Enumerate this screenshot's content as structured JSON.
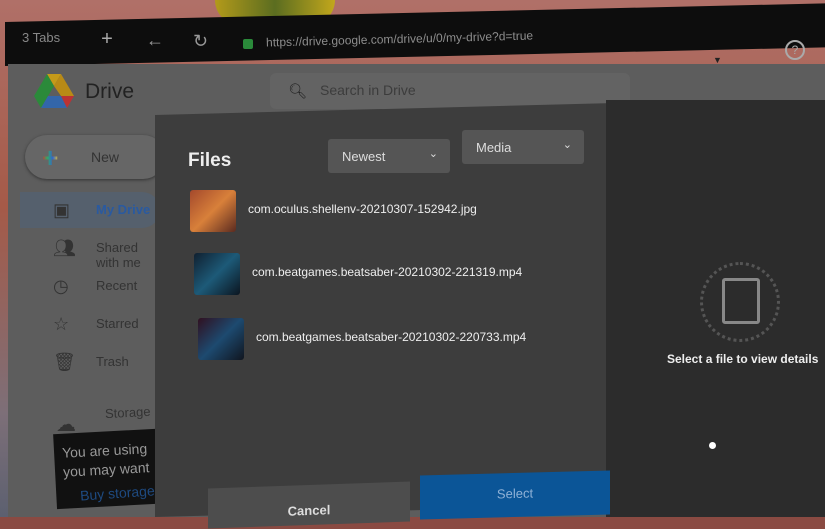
{
  "browser": {
    "tabs_label": "3 Tabs",
    "url": "https://drive.google.com/drive/u/0/my-drive?d=true"
  },
  "drive": {
    "brand": "Drive",
    "search_placeholder": "Search in Drive",
    "new_label": "New",
    "nav": [
      {
        "label": "My Drive",
        "icon": "my-drive-icon"
      },
      {
        "label": "Shared with me",
        "icon": "people-icon"
      },
      {
        "label": "Recent",
        "icon": "clock-icon"
      },
      {
        "label": "Starred",
        "icon": "star-icon"
      },
      {
        "label": "Trash",
        "icon": "trash-icon"
      }
    ],
    "storage_label": "Storage",
    "storage_tip": [
      "You are using",
      "you may want"
    ],
    "buy_storage": "Buy storage"
  },
  "dialog": {
    "title": "Files",
    "sort": "Newest",
    "filter": "Media",
    "files": [
      {
        "name": "com.oculus.shellenv-20210307-152942.jpg"
      },
      {
        "name": "com.beatgames.beatsaber-20210302-221319.mp4"
      },
      {
        "name": "com.beatgames.beatsaber-20210302-220733.mp4"
      }
    ],
    "details_placeholder": "Select a file to view details",
    "cancel": "Cancel",
    "select": "Select"
  }
}
